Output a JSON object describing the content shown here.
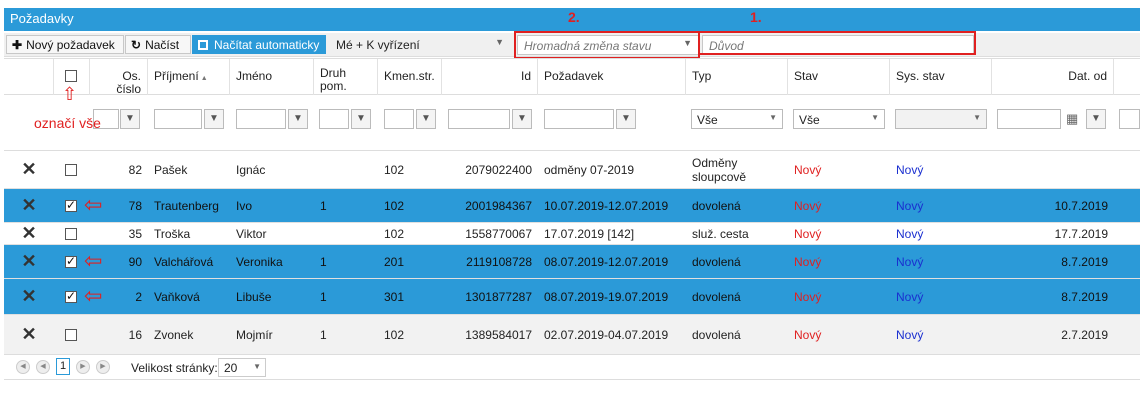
{
  "title": "Požadavky",
  "toolbar": {
    "new_request": "Nový požadavek",
    "load": "Načíst",
    "load_auto": "Načítat automaticky",
    "filter_select": "Mé + K vyřízení",
    "bulk_status_placeholder": "Hromadná změna stavu",
    "reason_placeholder": "Důvod"
  },
  "annotations": {
    "num1": "1.",
    "num2": "2.",
    "select_all": "označí vše"
  },
  "columns": [
    "Os. číslo",
    "Příjmení",
    "Jméno",
    "Druh pom.",
    "Kmen.str.",
    "Id",
    "Požadavek",
    "Typ",
    "Stav",
    "Sys. stav",
    "Dat. od"
  ],
  "filters": {
    "typ": "Vše",
    "stav": "Vše"
  },
  "rows": [
    {
      "checked": false,
      "os": "82",
      "prijmeni": "Pašek",
      "jmeno": "Ignác",
      "druh": "",
      "kmen": "102",
      "id": "2079022400",
      "pozadavek": "odměny 07-2019",
      "typ": "Odměny sloupcově",
      "stav": "Nový",
      "sys": "Nový",
      "datod": ""
    },
    {
      "checked": true,
      "os": "78",
      "prijmeni": "Trautenberg",
      "jmeno": "Ivo",
      "druh": "1",
      "kmen": "102",
      "id": "2001984367",
      "pozadavek": "10.07.2019-12.07.2019",
      "typ": "dovolená",
      "stav": "Nový",
      "sys": "Nový",
      "datod": "10.7.2019"
    },
    {
      "checked": false,
      "os": "35",
      "prijmeni": "Troška",
      "jmeno": "Viktor",
      "druh": "",
      "kmen": "102",
      "id": "1558770067",
      "pozadavek": "17.07.2019 [142]",
      "typ": "služ. cesta",
      "stav": "Nový",
      "sys": "Nový",
      "datod": "17.7.2019"
    },
    {
      "checked": true,
      "os": "90",
      "prijmeni": "Valchářová",
      "jmeno": "Veronika",
      "druh": "1",
      "kmen": "201",
      "id": "2119108728",
      "pozadavek": "08.07.2019-12.07.2019",
      "typ": "dovolená",
      "stav": "Nový",
      "sys": "Nový",
      "datod": "8.7.2019"
    },
    {
      "checked": true,
      "os": "2",
      "prijmeni": "Vaňková",
      "jmeno": "Libuše",
      "druh": "1",
      "kmen": "301",
      "id": "1301877287",
      "pozadavek": "08.07.2019-19.07.2019",
      "typ": "dovolená",
      "stav": "Nový",
      "sys": "Nový",
      "datod": "8.7.2019"
    },
    {
      "checked": false,
      "os": "16",
      "prijmeni": "Zvonek",
      "jmeno": "Mojmír",
      "druh": "1",
      "kmen": "102",
      "id": "1389584017",
      "pozadavek": "02.07.2019-04.07.2019",
      "typ": "dovolená",
      "stav": "Nový",
      "sys": "Nový",
      "datod": "2.7.2019"
    }
  ],
  "pager": {
    "page": "1",
    "page_size_label": "Velikost stránky:",
    "page_size": "20"
  },
  "colors": {
    "accent": "#2b9ad8",
    "annotation": "#e02020",
    "status_new": "#e02020",
    "sys_new": "#1a2fd0"
  }
}
